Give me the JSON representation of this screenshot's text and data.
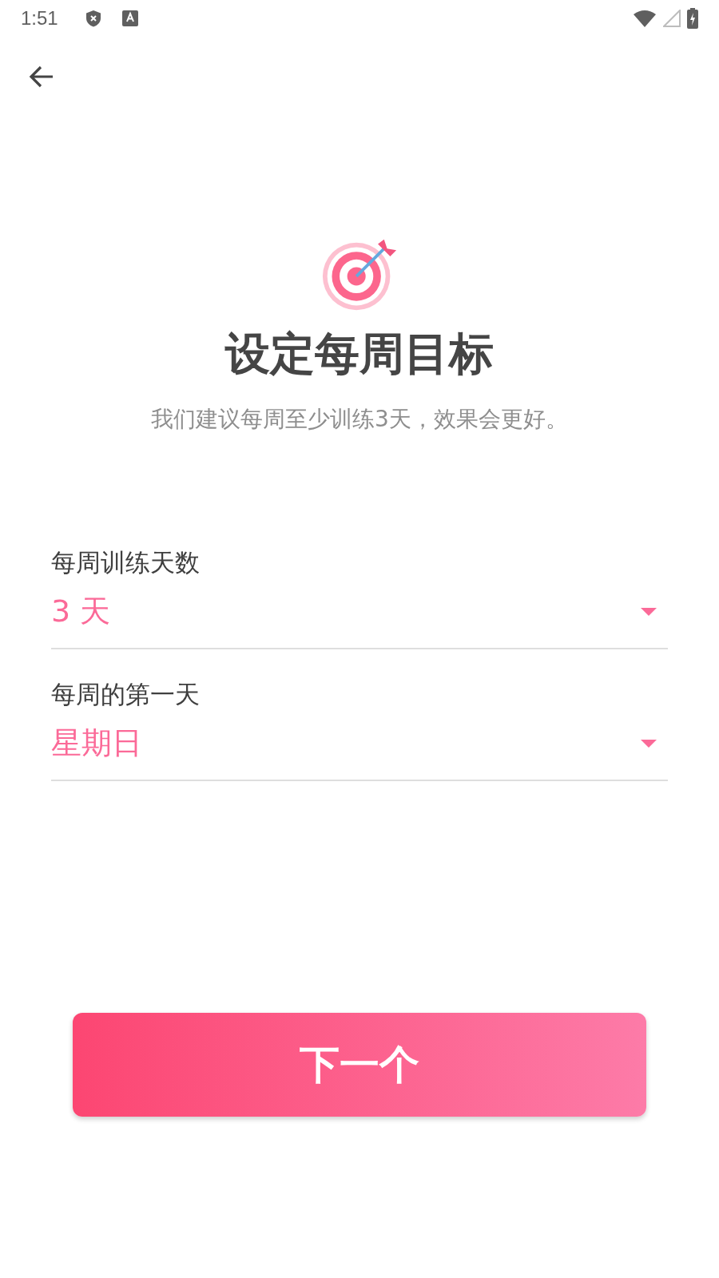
{
  "status_bar": {
    "time": "1:51"
  },
  "title": "设定每周目标",
  "subtitle": "我们建议每周至少训练3天，效果会更好。",
  "fields": [
    {
      "label": "每周训练天数",
      "value": "3 天"
    },
    {
      "label": "每周的第一天",
      "value": "星期日"
    }
  ],
  "next_button": "下一个"
}
